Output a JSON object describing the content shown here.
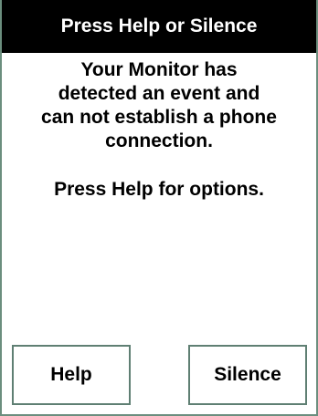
{
  "header": {
    "title": "Press Help or Silence"
  },
  "message": {
    "lines": [
      "Your Monitor has",
      "detected an event and",
      "can not establish a phone",
      "connection."
    ],
    "instruction": "Press Help for options."
  },
  "buttons": {
    "help_label": "Help",
    "silence_label": "Silence"
  },
  "colors": {
    "title_bg": "#000000",
    "title_text": "#ffffff",
    "border": "#6b8e7e",
    "text": "#000000",
    "background": "#ffffff"
  }
}
